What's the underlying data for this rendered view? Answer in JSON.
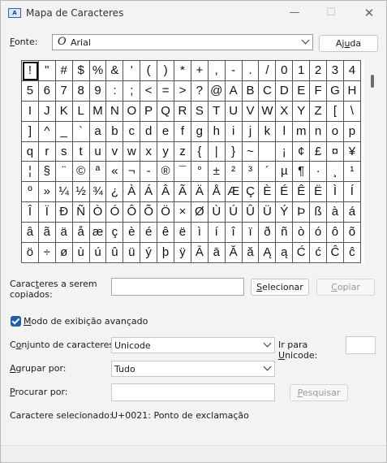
{
  "window": {
    "title": "Mapa de Caracteres",
    "icon": "charmap-app-icon"
  },
  "font": {
    "label": "Fonte:",
    "value": "Arial",
    "help_button": "Ajuda",
    "icon": "opentype-font-icon"
  },
  "chars": [
    "!",
    "\"",
    "#",
    "$",
    "%",
    "&",
    "'",
    "(",
    ")",
    "*",
    "+",
    ",",
    "-",
    ".",
    "/",
    "0",
    "1",
    "2",
    "3",
    "4",
    "5",
    "6",
    "7",
    "8",
    "9",
    ":",
    ";",
    "<",
    "=",
    ">",
    "?",
    "@",
    "A",
    "B",
    "C",
    "D",
    "E",
    "F",
    "G",
    "H",
    "I",
    "J",
    "K",
    "L",
    "M",
    "N",
    "O",
    "P",
    "Q",
    "R",
    "S",
    "T",
    "U",
    "V",
    "W",
    "X",
    "Y",
    "Z",
    "[",
    "\\",
    "]",
    "^",
    "_",
    "`",
    "a",
    "b",
    "c",
    "d",
    "e",
    "f",
    "g",
    "h",
    "i",
    "j",
    "k",
    "l",
    "m",
    "n",
    "o",
    "p",
    "q",
    "r",
    "s",
    "t",
    "u",
    "v",
    "w",
    "x",
    "y",
    "z",
    "{",
    "|",
    "}",
    "~",
    " ",
    "¡",
    "¢",
    "£",
    "¤",
    "¥",
    "¦",
    "§",
    "¨",
    "©",
    "ª",
    "«",
    "¬",
    "-",
    "®",
    "¯",
    "°",
    "±",
    "²",
    "³",
    "´",
    "µ",
    "¶",
    "·",
    "¸",
    "¹",
    "º",
    "»",
    "¼",
    "½",
    "¾",
    "¿",
    "À",
    "Á",
    "Â",
    "Ã",
    "Ä",
    "Å",
    "Æ",
    "Ç",
    "È",
    "É",
    "Ê",
    "Ë",
    "Ì",
    "Í",
    "Î",
    "Ï",
    "Ð",
    "Ñ",
    "Ò",
    "Ó",
    "Ô",
    "Õ",
    "Ö",
    "×",
    "Ø",
    "Ù",
    "Ú",
    "Û",
    "Ü",
    "Ý",
    "Þ",
    "ß",
    "à",
    "á",
    "â",
    "ã",
    "ä",
    "å",
    "æ",
    "ç",
    "è",
    "é",
    "ê",
    "ë",
    "ì",
    "í",
    "î",
    "ï",
    "ð",
    "ñ",
    "ò",
    "ó",
    "ô",
    "õ",
    "ö",
    "÷",
    "ø",
    "ù",
    "ú",
    "û",
    "ü",
    "ý",
    "þ",
    "ÿ",
    "Ā",
    "ā",
    "Ă",
    "ă",
    "Ą",
    "ą",
    "Ć",
    "ć",
    "Ĉ",
    "ĉ"
  ],
  "copy_section": {
    "label": "Caracteres a serem copiados:",
    "value": "",
    "select_button": "Selecionar",
    "copy_button": "Copiar"
  },
  "advanced": {
    "label": "Modo de exibição avançado",
    "checked": true
  },
  "charset": {
    "label": "Conjunto de caracteres:",
    "value": "Unicode"
  },
  "group_by": {
    "label": "Agrupar por:",
    "value": "Tudo"
  },
  "goto_unicode": {
    "label": "Ir para Unicode:",
    "value": ""
  },
  "search": {
    "label": "Procurar por:",
    "value": "",
    "button": "Pesquisar"
  },
  "selected": {
    "label": "Caractere selecionado:",
    "value": "U+0021: Ponto de exclamação"
  }
}
